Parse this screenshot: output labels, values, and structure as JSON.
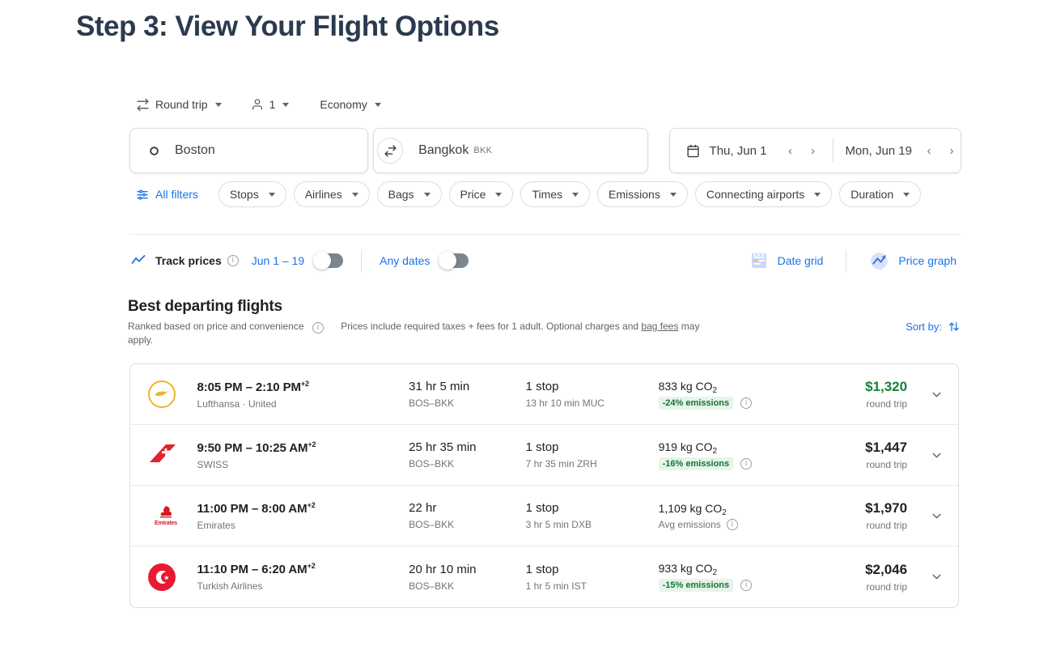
{
  "page_title": "Step 3: View Your Flight Options",
  "trip_options": [
    {
      "label": "Round trip",
      "icon": "swap-horizontal-icon"
    },
    {
      "label": "1",
      "icon": "person-icon"
    },
    {
      "label": "Economy",
      "icon": null
    }
  ],
  "search": {
    "origin": "Boston",
    "origin_icon": "circle-origin-icon",
    "destination": "Bangkok",
    "destination_code": "BKK",
    "destination_icon": "location-pin-icon",
    "swap_icon": "swap-arrows-icon",
    "calendar_icon": "calendar-icon",
    "depart_date": "Thu, Jun 1",
    "return_date": "Mon, Jun 19",
    "prev_chevron": "‹",
    "next_chevron": "›"
  },
  "filters": {
    "all_filters_label": "All filters",
    "all_filters_icon": "filter-sliders-icon",
    "chips": [
      "Stops",
      "Airlines",
      "Bags",
      "Price",
      "Times",
      "Emissions",
      "Connecting airports",
      "Duration"
    ]
  },
  "track": {
    "chart_icon": "trend-line-icon",
    "label": "Track prices",
    "info_icon": "info-icon",
    "date_range_label": "Jun 1 – 19",
    "date_range_toggle": "off",
    "any_dates_label": "Any dates",
    "any_dates_toggle": "off",
    "date_grid_label": "Date grid",
    "date_grid_icon": "date-grid-icon",
    "price_graph_label": "Price graph",
    "price_graph_icon": "price-graph-icon"
  },
  "results": {
    "title": "Best departing flights",
    "ranked_text": "Ranked based on price and convenience",
    "ranked_info_icon": "info-icon",
    "notice_prefix": "Prices include required taxes + fees for 1 adult. Optional charges and ",
    "notice_link": "bag fees",
    "notice_suffix": " may apply.",
    "sort_by_label": "Sort by:",
    "sort_by_icon": "sort-arrows-icon"
  },
  "accent_colors": {
    "blue": "#1a73e8",
    "green_price": "#188038",
    "badge_bg": "#e6f4ea",
    "badge_text": "#137333",
    "title_navy": "#2b3a4e"
  },
  "flights": [
    {
      "airline_logo": "lufthansa-logo",
      "times": "8:05 PM – 2:10 PM",
      "day_offset": "+2",
      "airlines": "Lufthansa · United",
      "duration": "31 hr 5 min",
      "route": "BOS–BKK",
      "stops": "1 stop",
      "layover": "13 hr 10 min MUC",
      "co2": "833 kg CO",
      "co2_sub": "2",
      "emissions_badge": "-24% emissions",
      "emissions_avg": null,
      "emissions_info_icon": "info-icon",
      "price": "$1,320",
      "price_green": true,
      "price_sub": "round trip",
      "expand_icon": "chevron-down-icon"
    },
    {
      "airline_logo": "swiss-logo",
      "times": "9:50 PM – 10:25 AM",
      "day_offset": "+2",
      "airlines": "SWISS",
      "duration": "25 hr 35 min",
      "route": "BOS–BKK",
      "stops": "1 stop",
      "layover": "7 hr 35 min ZRH",
      "co2": "919 kg CO",
      "co2_sub": "2",
      "emissions_badge": "-16% emissions",
      "emissions_avg": null,
      "emissions_info_icon": "info-icon",
      "price": "$1,447",
      "price_green": false,
      "price_sub": "round trip",
      "expand_icon": "chevron-down-icon"
    },
    {
      "airline_logo": "emirates-logo",
      "times": "11:00 PM – 8:00 AM",
      "day_offset": "+2",
      "airlines": "Emirates",
      "duration": "22 hr",
      "route": "BOS–BKK",
      "stops": "1 stop",
      "layover": "3 hr 5 min DXB",
      "co2": "1,109 kg CO",
      "co2_sub": "2",
      "emissions_badge": null,
      "emissions_avg": "Avg emissions",
      "emissions_info_icon": "info-icon",
      "price": "$1,970",
      "price_green": false,
      "price_sub": "round trip",
      "expand_icon": "chevron-down-icon"
    },
    {
      "airline_logo": "turkish-logo",
      "times": "11:10 PM – 6:20 AM",
      "day_offset": "+2",
      "airlines": "Turkish Airlines",
      "duration": "20 hr 10 min",
      "route": "BOS–BKK",
      "stops": "1 stop",
      "layover": "1 hr 5 min IST",
      "co2": "933 kg CO",
      "co2_sub": "2",
      "emissions_badge": "-15% emissions",
      "emissions_avg": null,
      "emissions_info_icon": "info-icon",
      "price": "$2,046",
      "price_green": false,
      "price_sub": "round trip",
      "expand_icon": "chevron-down-icon"
    }
  ]
}
